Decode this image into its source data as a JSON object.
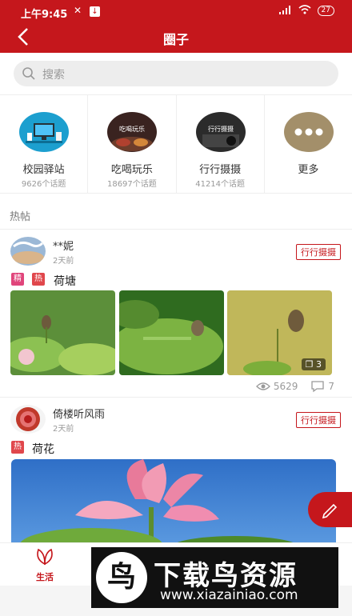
{
  "status_bar": {
    "time": "上午9:45",
    "signal": "📶",
    "wifi": "◠",
    "battery": "27"
  },
  "header": {
    "title": "圈子"
  },
  "search": {
    "placeholder": "搜索"
  },
  "circles": [
    {
      "name": "校园驿站",
      "count": "9626个话题",
      "image_text": ""
    },
    {
      "name": "吃喝玩乐",
      "count": "18697个话题",
      "image_text": "吃喝玩乐"
    },
    {
      "name": "行行摄摄",
      "count": "41214个话题",
      "image_text": "行行摄摄"
    },
    {
      "name": "更多",
      "count": ""
    }
  ],
  "section": {
    "hot_posts": "热帖"
  },
  "posts": [
    {
      "user": "**妮",
      "time": "2天前",
      "tag": "行行摄摄",
      "badges": [
        "精",
        "热"
      ],
      "title": "荷塘",
      "image_count": "3",
      "views": "5629",
      "comments": "7"
    },
    {
      "user": "倚楼听风雨",
      "time": "2天前",
      "tag": "行行摄摄",
      "badges": [
        "热"
      ],
      "title": "荷花"
    }
  ],
  "tabbar": {
    "life": "生活"
  },
  "watermark": {
    "name": "下载鸟资源",
    "url": "www.xiazainiao.com",
    "logo_char": "鸟"
  },
  "colors": {
    "brand": "#c5171c",
    "badge_jing": "#e0457b",
    "badge_re": "#e0474c"
  }
}
